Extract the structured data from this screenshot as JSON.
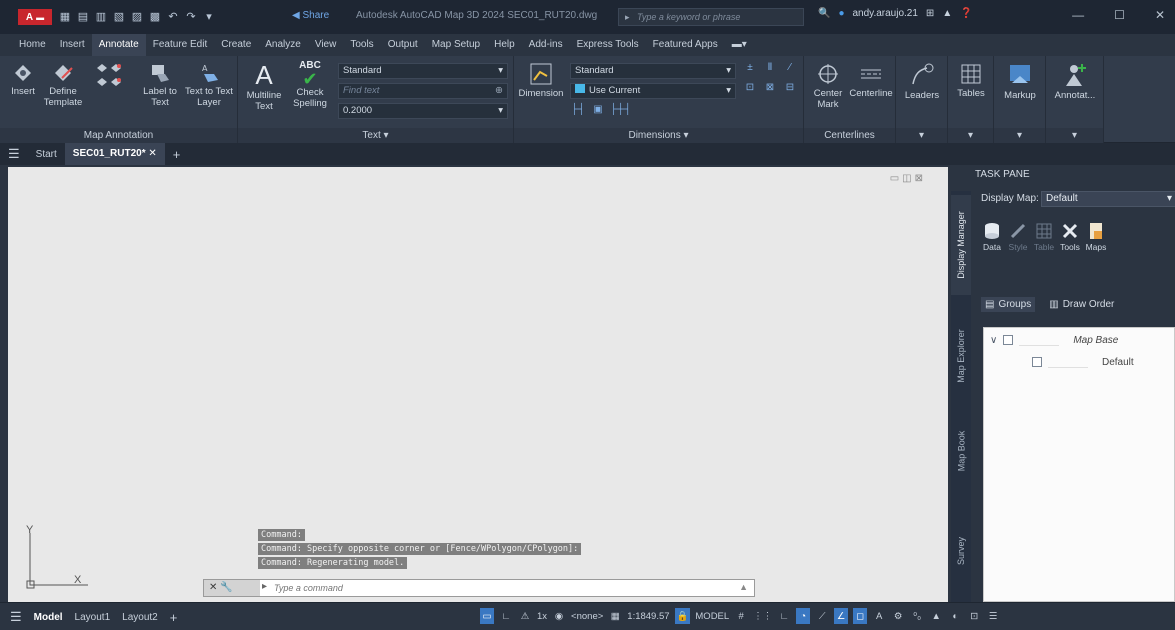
{
  "titlebar": {
    "app_button": "A",
    "share": "Share",
    "title": "Autodesk AutoCAD Map 3D 2024  SEC01_RUT20.dwg",
    "search_placeholder": "Type a keyword or phrase",
    "user": "andy.araujo.21"
  },
  "menu": [
    "Home",
    "Insert",
    "Annotate",
    "Feature Edit",
    "Create",
    "Analyze",
    "View",
    "Tools",
    "Output",
    "Map Setup",
    "Help",
    "Add-ins",
    "Express Tools",
    "Featured Apps"
  ],
  "menu_active": "Annotate",
  "ribbon": {
    "map_annotation": {
      "title": "Map Annotation",
      "insert": "Insert",
      "define_template": "Define Template",
      "label_to_text": "Label to Text",
      "text_to_text_layer": "Text to Text Layer"
    },
    "text": {
      "title": "Text",
      "multiline": "Multiline Text",
      "check_spelling": "Check Spelling",
      "abc": "ABC",
      "style_value": "Standard",
      "find_placeholder": "Find text",
      "height_value": "0.2000"
    },
    "dimensions": {
      "title": "Dimensions",
      "dimension": "Dimension",
      "style_value": "Standard",
      "layer_value": "Use Current"
    },
    "centerlines": {
      "title": "Centerlines",
      "center_mark": "Center Mark",
      "centerline": "Centerline"
    },
    "leaders": "Leaders",
    "tables": "Tables",
    "markup": "Markup",
    "annotate": "Annotat..."
  },
  "doctabs": {
    "start": "Start",
    "active": "SEC01_RUT20*"
  },
  "drawing": {
    "ucs_x": "X",
    "ucs_y": "Y",
    "history": [
      "Command:",
      "Command: Specify opposite corner or [Fence/WPolygon/CPolygon]:",
      "Command: Regenerating model."
    ],
    "cmd_placeholder": "Type a command"
  },
  "taskpane": {
    "header": "TASK PANE",
    "vtabs": [
      "Display Manager",
      "Map Explorer",
      "Map Book",
      "Survey"
    ],
    "display_map_label": "Display Map:",
    "display_map_value": "Default",
    "tools": [
      "Data",
      "Style",
      "Table",
      "Tools",
      "Maps"
    ],
    "groups": "Groups",
    "draw_order": "Draw Order",
    "tree": {
      "root": "Map Base",
      "child": "Default"
    }
  },
  "statusbar": {
    "model": "Model",
    "layout1": "Layout1",
    "layout2": "Layout2",
    "annotation_scale": "1x",
    "none": "<none>",
    "scale": "1:1849.57",
    "model_space": "MODEL"
  }
}
